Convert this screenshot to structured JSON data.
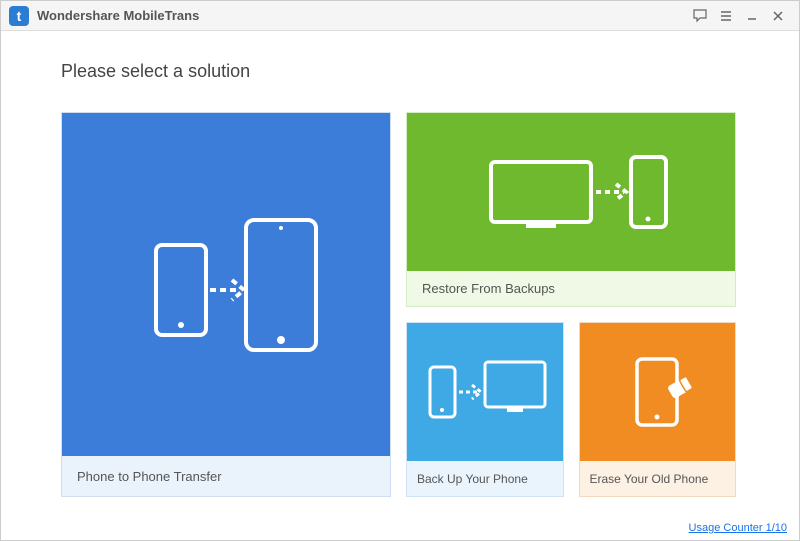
{
  "titlebar": {
    "logo_letter": "t",
    "title": "Wondershare MobileTrans"
  },
  "heading": "Please select a solution",
  "cards": {
    "phone_to_phone": "Phone to Phone Transfer",
    "restore": "Restore From Backups",
    "backup": "Back Up Your Phone",
    "erase": "Erase Your Old Phone"
  },
  "footer": {
    "usage_counter": "Usage Counter 1/10"
  },
  "colors": {
    "blue": "#3b7dd8",
    "green": "#6fb92e",
    "lightblue": "#3fa9e5",
    "orange": "#f08c22"
  }
}
